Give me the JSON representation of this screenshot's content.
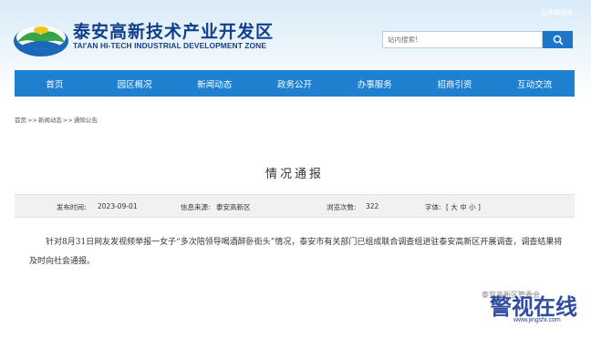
{
  "header": {
    "title_cn": "泰安高新技术产业开发区",
    "title_en": "TAI'AN HI-TECH INDUSTRIAL DEVELOPMENT ZONE",
    "accessibility": "无障碍阅读",
    "logo_icon": "mountain-sun-logo-icon"
  },
  "search": {
    "placeholder": "站内搜索!",
    "icon": "search-icon"
  },
  "nav": {
    "items": [
      "首页",
      "园区概况",
      "新闻动态",
      "政务公开",
      "办事服务",
      "招商引资",
      "互动交流"
    ]
  },
  "breadcrumb": [
    "首页",
    "新闻动态",
    "通知公告"
  ],
  "breadcrumb_sep": ">>",
  "article": {
    "title": "情况通报",
    "date_label": "发布时间:",
    "date": "2023-09-01",
    "source_label": "信息来源:",
    "source": "泰安高新区",
    "views_label": "浏览次数:",
    "views": "322",
    "font_label": "字体:",
    "font_sizes": "[ 大 中 小 ]",
    "body": "针对8月31日网友发视频举报一女子“多次陪领导喝酒醉卧街头”情况，泰安市有关部门已组成联合调查组进驻泰安高新区开展调查，调查结果将及时向社会通报。"
  },
  "footer": {
    "sign": "泰安高新区管委会"
  },
  "watermark": {
    "text": "警视在线",
    "url": "www.jingshi.com"
  },
  "colors": {
    "nav_bg": "#1f80cf",
    "search_button": "#1d76c9",
    "title_blue": "#123e8c"
  }
}
